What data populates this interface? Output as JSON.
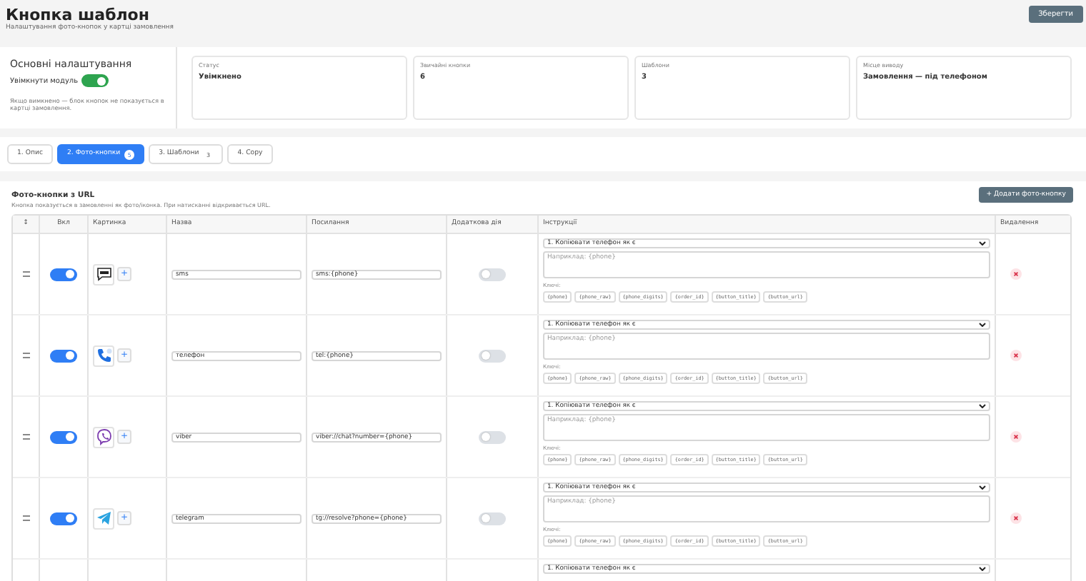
{
  "header": {
    "title": "Кнопка шаблон",
    "subtitle": "Налаштування фото-кнопок у картці замовлення",
    "save_button": "Зберегти"
  },
  "settings": {
    "title": "Основні налаштування",
    "toggle_label": "Увімкнути модуль",
    "enabled": true,
    "note": "Якщо вимкнено — блок кнопок не показується в картці замовлення."
  },
  "stats": [
    {
      "label": "Статус",
      "value": "Увімкнено"
    },
    {
      "label": "Звичайні кнопки",
      "value": "6"
    },
    {
      "label": "Шаблони",
      "value": "3"
    },
    {
      "label": "Місце виводу",
      "value": "Замовлення — під телефоном"
    }
  ],
  "tabs": [
    {
      "label": "1. Опис",
      "selected": false
    },
    {
      "label": "2. Фото-кнопки",
      "badge": "5",
      "selected": true
    },
    {
      "label": "3. Шаблони",
      "badge": "3",
      "selected": false
    },
    {
      "label": "4. Copy",
      "selected": false
    }
  ],
  "section": {
    "title": "Фото-кнопки з URL",
    "description": "Кнопка показується в замовленні як фото/іконка. При натисканні відкривається URL.",
    "add_button": "+ Додати фото-кнопку"
  },
  "table": {
    "columns": [
      "↕",
      "Вкл",
      "Картинка",
      "Назва",
      "Посилання",
      "Додаткова дія",
      "Інструкції",
      "Видалення"
    ],
    "rows": [
      {
        "kind": "sms",
        "enabled": true,
        "add_image": "+",
        "name": "sms",
        "url": "sms:{phone}",
        "extra_action": false,
        "instruction": "1. Копіювати телефон як є",
        "placeholder": "Наприклад: {phone}",
        "keys_label": "Ключі:",
        "keys": [
          "{phone}",
          "{phone_raw}",
          "{phone_digits}",
          "{order_id}",
          "{button_title}",
          "{button_url}"
        ]
      },
      {
        "kind": "phone",
        "enabled": true,
        "add_image": "+",
        "name": "телефон",
        "url": "tel:{phone}",
        "extra_action": false,
        "instruction": "1. Копіювати телефон як є",
        "placeholder": "Наприклад: {phone}",
        "keys_label": "Ключі:",
        "keys": [
          "{phone}",
          "{phone_raw}",
          "{phone_digits}",
          "{order_id}",
          "{button_title}",
          "{button_url}"
        ]
      },
      {
        "kind": "viber",
        "enabled": true,
        "add_image": "+",
        "name": "viber",
        "url": "viber://chat?number={phone}",
        "extra_action": false,
        "instruction": "1. Копіювати телефон як є",
        "placeholder": "Наприклад: {phone}",
        "keys_label": "Ключі:",
        "keys": [
          "{phone}",
          "{phone_raw}",
          "{phone_digits}",
          "{order_id}",
          "{button_title}",
          "{button_url}"
        ]
      },
      {
        "kind": "telegram",
        "enabled": true,
        "add_image": "+",
        "name": "telegram",
        "url": "tg://resolve?phone={phone}",
        "extra_action": false,
        "instruction": "1. Копіювати телефон як є",
        "placeholder": "Наприклад: {phone}",
        "keys_label": "Ключі:",
        "keys": [
          "{phone}",
          "{phone_raw}",
          "{phone_digits}",
          "{order_id}",
          "{button_title}",
          "{button_url}"
        ]
      },
      {
        "kind": "cut",
        "instruction": "1. Копіювати телефон як є"
      }
    ]
  }
}
